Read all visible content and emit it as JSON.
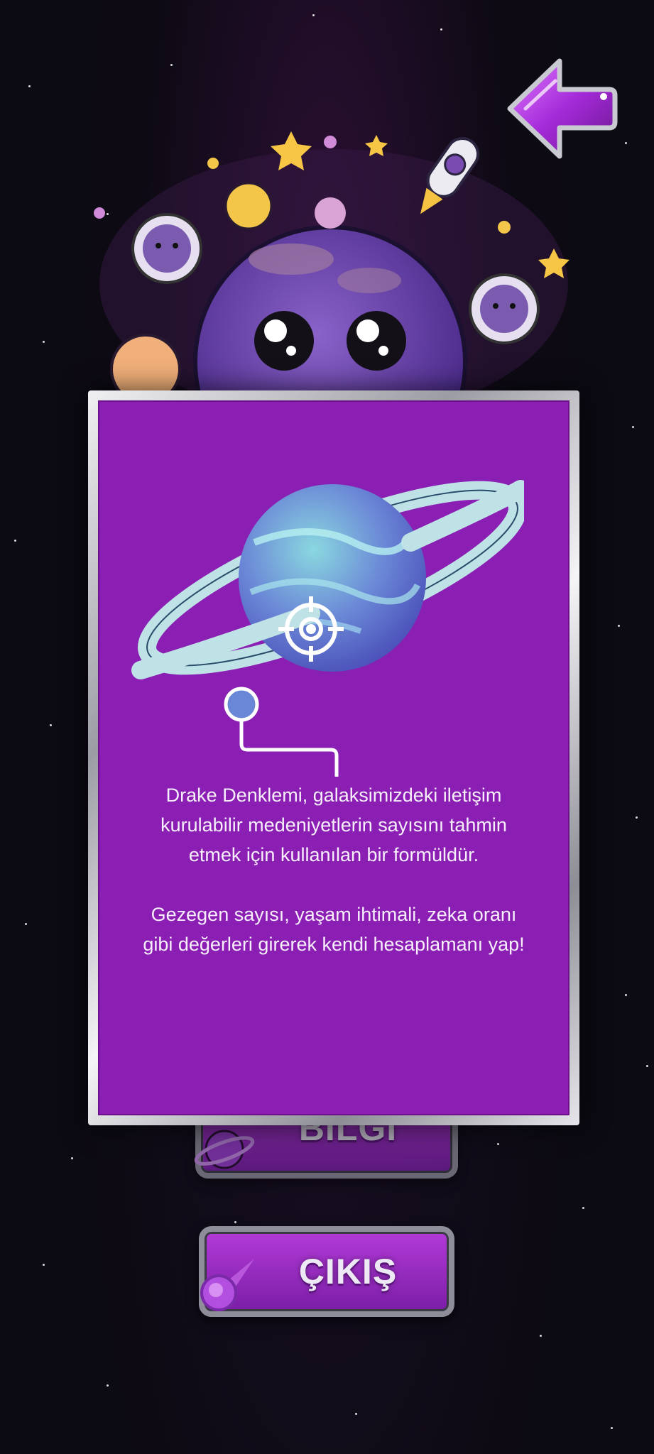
{
  "colors": {
    "background": "#0c0a12",
    "modal_panel": "#8b1fb3",
    "modal_frame": "#c9c9cf",
    "button_purple": "#9a2cc4",
    "back_arrow": "#b03ae0"
  },
  "icons": {
    "back": "arrow-left-icon",
    "crosshair": "crosshair-icon",
    "planet": "ringed-planet-icon",
    "comet": "comet-icon"
  },
  "modal": {
    "paragraph_1": "Drake Denklemi, galaksimizdeki iletişim kurulabilir medeniyetlerin sayısını tahmin etmek için kullanılan bir formüldür.",
    "paragraph_2": "Gezegen sayısı, yaşam ihtimali, zeka oranı gibi değerleri girerek kendi hesaplamanı yap!"
  },
  "menu": {
    "info_label": "BİLGİ",
    "exit_label": "ÇIKIŞ"
  }
}
